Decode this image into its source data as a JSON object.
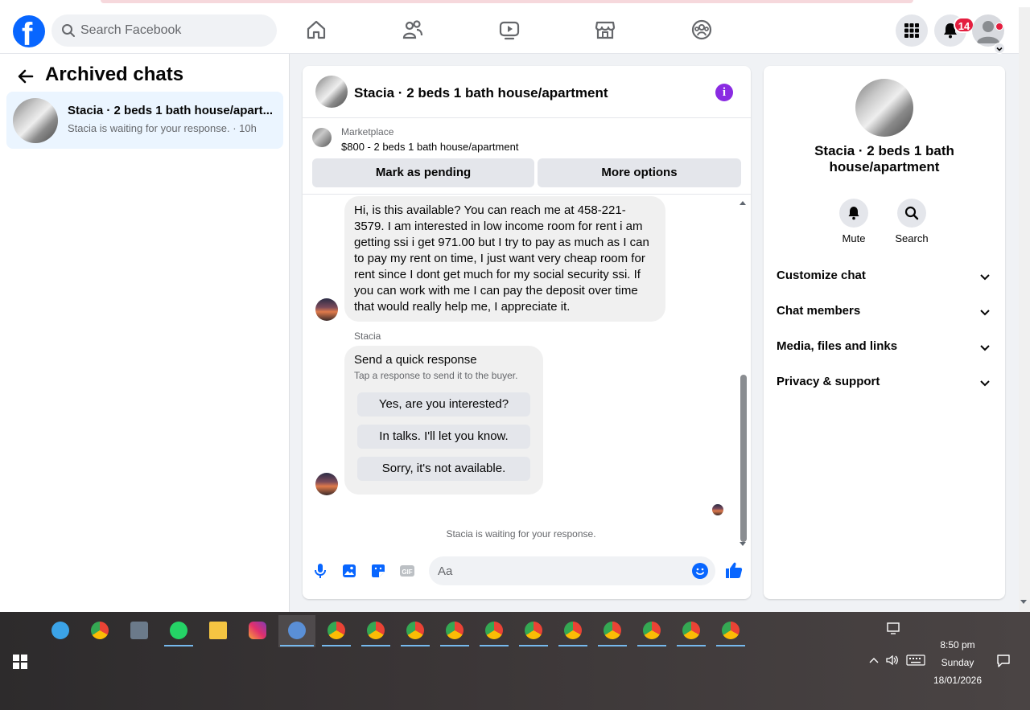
{
  "header": {
    "search_placeholder": "Search Facebook",
    "notification_count": "14"
  },
  "left_panel": {
    "title": "Archived chats",
    "chats": [
      {
        "name": "Stacia · 2 beds 1 bath house/apart...",
        "preview": "Stacia is waiting for your response. · 10h"
      }
    ]
  },
  "chat": {
    "title": "Stacia · 2 beds 1 bath house/apartment",
    "marketplace_label": "Marketplace",
    "listing": "$800 - 2 beds 1 bath house/apartment",
    "mark_pending": "Mark as pending",
    "more_options": "More options",
    "message": "Hi, is this available? You can reach me at 458-221-3579. I am interested in low income room for rent i am getting ssi i get 971.00 but I try to pay as much as I can to pay my rent on time, I just want very cheap room for rent since I dont get much for my social security ssi. If you can work with me I can pay the deposit over time that would really help me, I appreciate it.",
    "sender_name": "Stacia",
    "quick_title": "Send a quick response",
    "quick_subtitle": "Tap a response to send it to the buyer.",
    "quick_replies": [
      "Yes, are you interested?",
      "In talks. I'll let you know.",
      "Sorry, it's not available."
    ],
    "waiting": "Stacia is waiting for your response.",
    "composer_placeholder": "Aa"
  },
  "right_panel": {
    "name": "Stacia · 2 beds 1 bath house/apartment",
    "actions": [
      "Mute",
      "Search"
    ],
    "sections": [
      "Customize chat",
      "Chat members",
      "Media, files and links",
      "Privacy & support"
    ]
  },
  "taskbar": {
    "time": "8:50 pm",
    "day": "Sunday",
    "date": "18/01/2026"
  },
  "colors": {
    "brand": "#0866ff",
    "badge": "#e41e3f",
    "info": "#8a2be2"
  }
}
